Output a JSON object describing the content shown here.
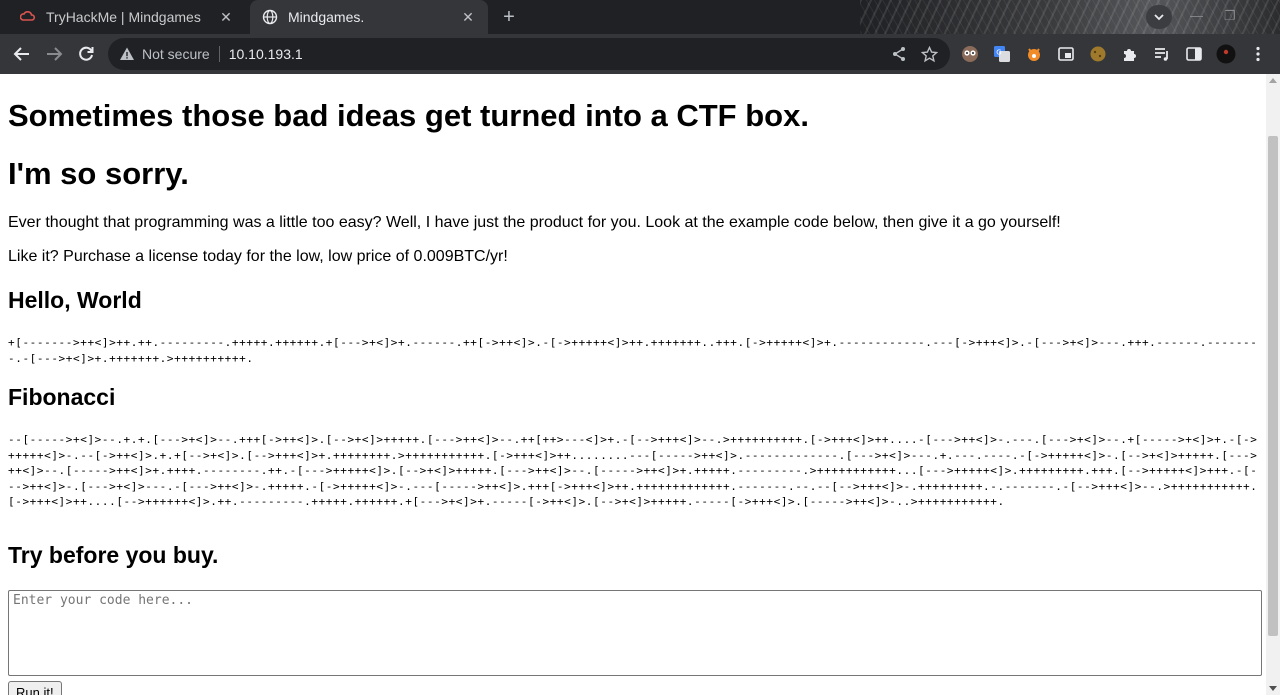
{
  "browser": {
    "tabs": [
      {
        "title": "TryHackMe | Mindgames",
        "active": false,
        "favicon": "tryhackme-icon"
      },
      {
        "title": "Mindgames.",
        "active": true,
        "favicon": "globe-icon"
      }
    ],
    "address": {
      "security_label": "Not secure",
      "url": "10.10.193.1"
    }
  },
  "page": {
    "heading": "Sometimes those bad ideas get turned into a CTF box.",
    "subheading": "I'm so sorry.",
    "intro": "Ever thought that programming was a little too easy? Well, I have just the product for you. Look at the example code below, then give it a go yourself!",
    "price_line": "Like it? Purchase a license today for the low, low price of 0.009BTC/yr!",
    "examples": [
      {
        "title": "Hello, World",
        "code": "+[------->++<]>++.++.---------.+++++.++++++.+[--->+<]>+.------.++[->++<]>.-[->+++++<]>++.+++++++..+++.[->+++++<]>+.------------.---[->+++<]>.-[--->+<]>---.+++.------.--------.-[--->+<]>+.+++++++.>++++++++++."
      },
      {
        "title": "Fibonacci",
        "code": "--[----->+<]>--.+.+.[--->+<]>--.+++[->++<]>.[-->+<]>+++++.[--->++<]>--.++[++>---<]>+.-[-->+++<]>--.>++++++++++.[->+++<]>++....-[--->++<]>-.---.[--->+<]>--.+[----->+<]>+.-[->+++++<]>-.--[->++<]>.+.+[-->+<]>.[-->+++<]>+.++++++++.>+++++++++++.[->+++<]>++........---[----->++<]>.-------------.[--->+<]>---.+.---.----.-[->+++++<]>-.[-->+<]>+++++.[--->++<]>--.[----->++<]>+.++++.--------.++.-[--->+++++<]>.[-->+<]>+++++.[--->++<]>--.[----->++<]>+.+++++.---------.>+++++++++++...[--->+++++<]>.+++++++++.+++.[-->+++++<]>+++.-[--->++<]>-.[--->+<]>---.-[--->++<]>-.+++++.-[->+++++<]>-.---[----->++<]>.+++[->+++<]>++.+++++++++++++.-------.--.--[-->+++<]>-.+++++++++.-.-------.-[-->+++<]>--.>+++++++++++.[->+++<]>++....[-->++++++<]>.++.---------.+++++.++++++.+[--->+<]>+.-----[->++<]>.[-->+<]>+++++.-----[->+++<]>.[----->++<]>-..>+++++++++++."
      }
    ],
    "try_heading": "Try before you buy.",
    "code_input": {
      "placeholder": "Enter your code here...",
      "value": ""
    },
    "run_button": "Run it!"
  },
  "colors": {
    "tab_strip": "#202124",
    "toolbar": "#35363a",
    "omnibox": "#202124",
    "thm_red": "#c0392b"
  }
}
